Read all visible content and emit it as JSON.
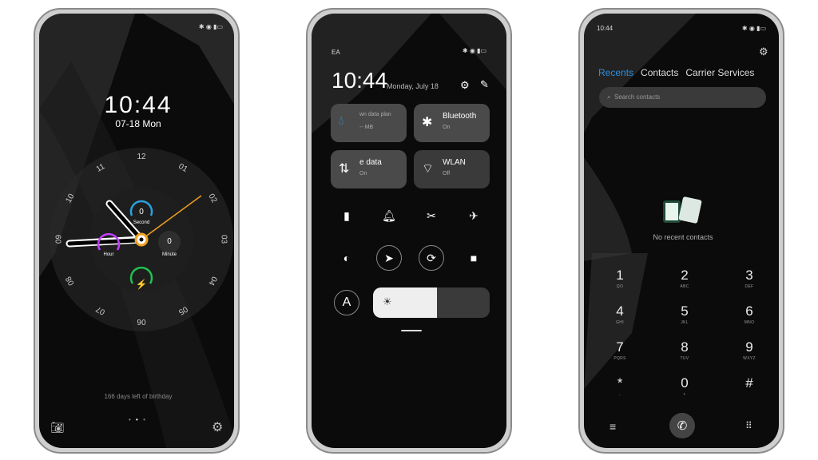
{
  "lockscreen": {
    "time": "10:44",
    "date": "07-18 Mon",
    "dial_numbers": [
      "12",
      "01",
      "02",
      "03",
      "04",
      "05",
      "06",
      "07",
      "08",
      "09",
      "10",
      "11"
    ],
    "gauges": {
      "second": {
        "value": "0",
        "label": "Second"
      },
      "minute": {
        "value": "0",
        "label": "Minute"
      },
      "hour": {
        "label": "Hour"
      }
    },
    "birthday_text": "166 days left of birthday",
    "accent": "#f0a020",
    "icons": [
      "camera-icon",
      "settings-icon"
    ]
  },
  "control_center": {
    "carrier": "EA",
    "time": "10:44",
    "date": "Monday, July 18",
    "tiles": [
      {
        "title": "wn data plan",
        "sub": "-- MB",
        "icon": "drop-icon"
      },
      {
        "title": "Bluetooth",
        "sub": "On",
        "icon": "bluetooth-icon"
      },
      {
        "title": "e data",
        "sub": "On",
        "icon": "mobile-data-icon"
      },
      {
        "title": "WLAN",
        "sub": "Off",
        "icon": "wifi-icon"
      }
    ],
    "brightness_percent": 55,
    "auto_brightness_label": "A"
  },
  "dialer": {
    "status_time": "10:44",
    "tabs": [
      "Recents",
      "Contacts",
      "Carrier Services"
    ],
    "active_tab_color": "#2a8ee0",
    "search_placeholder": "Search contacts",
    "empty_text": "No recent contacts",
    "keys": [
      {
        "n": "1",
        "l": "QO"
      },
      {
        "n": "2",
        "l": "ABC"
      },
      {
        "n": "3",
        "l": "DEF"
      },
      {
        "n": "4",
        "l": "GHI"
      },
      {
        "n": "5",
        "l": "JKL"
      },
      {
        "n": "6",
        "l": "MNO"
      },
      {
        "n": "7",
        "l": "PQRS"
      },
      {
        "n": "8",
        "l": "TUV"
      },
      {
        "n": "9",
        "l": "WXYZ"
      },
      {
        "n": "*",
        "l": ","
      },
      {
        "n": "0",
        "l": "+"
      },
      {
        "n": "#",
        "l": ""
      }
    ]
  }
}
